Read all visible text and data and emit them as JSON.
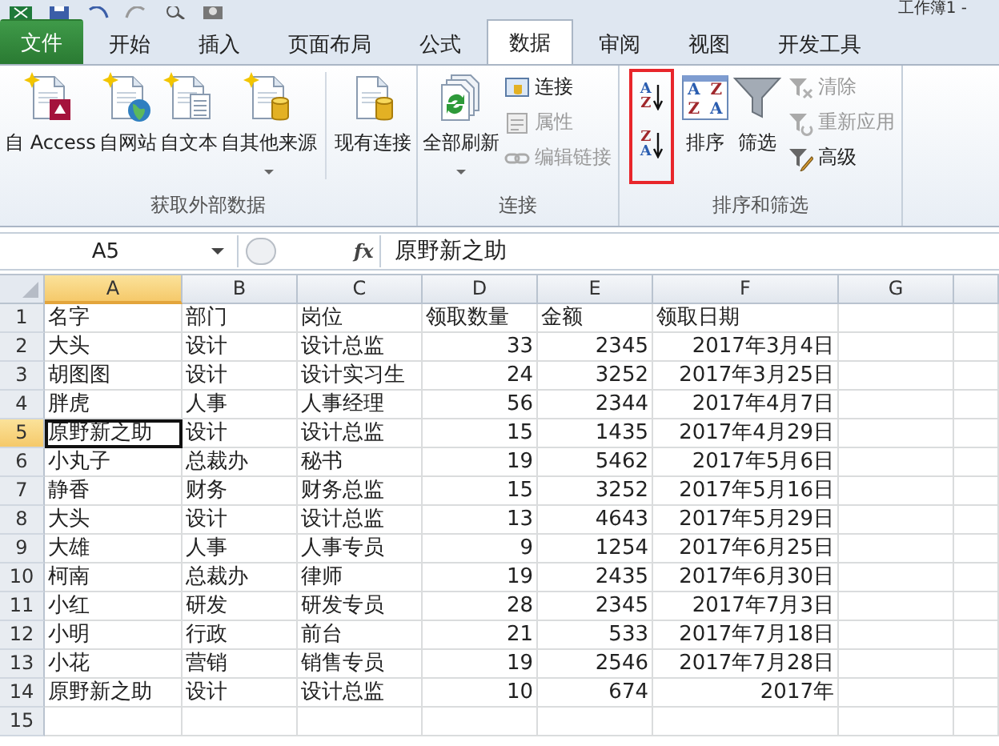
{
  "title_bar": {
    "title": "工作簿1 -"
  },
  "tabs": [
    {
      "label": "文件",
      "kind": "file",
      "selected": false
    },
    {
      "label": "开始",
      "kind": "tab",
      "selected": false
    },
    {
      "label": "插入",
      "kind": "tab",
      "selected": false
    },
    {
      "label": "页面布局",
      "kind": "tab",
      "selected": false
    },
    {
      "label": "公式",
      "kind": "tab",
      "selected": false
    },
    {
      "label": "数据",
      "kind": "tab",
      "selected": true
    },
    {
      "label": "审阅",
      "kind": "tab",
      "selected": false
    },
    {
      "label": "视图",
      "kind": "tab",
      "selected": false
    },
    {
      "label": "开发工具",
      "kind": "tab",
      "selected": false
    }
  ],
  "ribbon": {
    "groups": [
      {
        "label": "获取外部数据",
        "items": [
          {
            "kind": "large",
            "label": "自 Access",
            "dropdown": false
          },
          {
            "kind": "large",
            "label": "自网站",
            "dropdown": false
          },
          {
            "kind": "large",
            "label": "自文本",
            "dropdown": false
          },
          {
            "kind": "large",
            "label": "自其他来源",
            "dropdown": true
          },
          {
            "kind": "separator"
          },
          {
            "kind": "large",
            "label": "现有连接",
            "dropdown": false
          }
        ]
      },
      {
        "label": "连接",
        "items": [
          {
            "kind": "large",
            "label": "全部刷新",
            "dropdown": true
          },
          {
            "kind": "stack",
            "items": [
              {
                "label": "连接",
                "disabled": false
              },
              {
                "label": "属性",
                "disabled": true
              },
              {
                "label": "编辑链接",
                "disabled": true
              }
            ]
          }
        ]
      },
      {
        "label": "排序和筛选",
        "items": [
          {
            "kind": "sortpair",
            "highlighted": true,
            "buttons": [
              {
                "glyphs": [
                  {
                    "text": "A",
                    "color": "#2a5db0"
                  },
                  {
                    "text": "Z",
                    "color": "#a0282c"
                  }
                ]
              },
              {
                "glyphs": [
                  {
                    "text": "Z",
                    "color": "#a0282c"
                  },
                  {
                    "text": "A",
                    "color": "#2a5db0"
                  }
                ]
              }
            ]
          },
          {
            "kind": "sortgrid",
            "label": "排序",
            "glyphs": [
              {
                "text": "A",
                "color": "#2a5db0"
              },
              {
                "text": "Z",
                "color": "#a0282c"
              },
              {
                "text": "Z",
                "color": "#a0282c"
              },
              {
                "text": "A",
                "color": "#2a5db0"
              }
            ]
          },
          {
            "kind": "large",
            "label": "筛选",
            "dropdown": false
          },
          {
            "kind": "stack",
            "items": [
              {
                "label": "清除",
                "disabled": true
              },
              {
                "label": "重新应用",
                "disabled": true
              },
              {
                "label": "高级",
                "disabled": false
              }
            ]
          }
        ]
      }
    ]
  },
  "formula_bar": {
    "name_box": "A5",
    "function_button": "fx",
    "value": "原野新之助"
  },
  "sheet": {
    "columns": [
      {
        "label": "A",
        "selected": true
      },
      {
        "label": "B",
        "selected": false
      },
      {
        "label": "C",
        "selected": false
      },
      {
        "label": "D",
        "selected": false
      },
      {
        "label": "E",
        "selected": false
      },
      {
        "label": "F",
        "selected": false
      },
      {
        "label": "G",
        "selected": false
      }
    ],
    "rows": [
      {
        "number": "1",
        "selected": false,
        "cells": [
          "名字",
          "部门",
          "岗位",
          "领取数量",
          "金额",
          "领取日期"
        ]
      },
      {
        "number": "2",
        "selected": false,
        "cells": [
          "大头",
          "设计",
          "设计总监"
        ],
        "figures": [
          "33",
          "2345",
          "2017年3月4日"
        ]
      },
      {
        "number": "3",
        "selected": false,
        "cells": [
          "胡图图",
          "设计",
          "设计实习生"
        ],
        "figures": [
          "24",
          "3252",
          "2017年3月25日"
        ]
      },
      {
        "number": "4",
        "selected": false,
        "cells": [
          "胖虎",
          "人事",
          "人事经理"
        ],
        "figures": [
          "56",
          "2344",
          "2017年4月7日"
        ]
      },
      {
        "number": "5",
        "selected": true,
        "cells": [
          "原野新之助",
          "设计",
          "设计总监"
        ],
        "figures": [
          "15",
          "1435",
          "2017年4月29日"
        ]
      },
      {
        "number": "6",
        "selected": false,
        "cells": [
          "小丸子",
          "总裁办",
          "秘书"
        ],
        "figures": [
          "19",
          "5462",
          "2017年5月6日"
        ]
      },
      {
        "number": "7",
        "selected": false,
        "cells": [
          "静香",
          "财务",
          "财务总监"
        ],
        "figures": [
          "15",
          "3252",
          "2017年5月16日"
        ]
      },
      {
        "number": "8",
        "selected": false,
        "cells": [
          "大头",
          "设计",
          "设计总监"
        ],
        "figures": [
          "13",
          "4643",
          "2017年5月29日"
        ]
      },
      {
        "number": "9",
        "selected": false,
        "cells": [
          "大雄",
          "人事",
          "人事专员"
        ],
        "figures": [
          "9",
          "1254",
          "2017年6月25日"
        ]
      },
      {
        "number": "10",
        "selected": false,
        "cells": [
          "柯南",
          "总裁办",
          "律师"
        ],
        "figures": [
          "19",
          "2435",
          "2017年6月30日"
        ]
      },
      {
        "number": "11",
        "selected": false,
        "cells": [
          "小红",
          "研发",
          "研发专员"
        ],
        "figures": [
          "28",
          "2345",
          "2017年7月3日"
        ]
      },
      {
        "number": "12",
        "selected": false,
        "cells": [
          "小明",
          "行政",
          "前台"
        ],
        "figures": [
          "21",
          "533",
          "2017年7月18日"
        ]
      },
      {
        "number": "13",
        "selected": false,
        "cells": [
          "小花",
          "营销",
          "销售专员"
        ],
        "figures": [
          "19",
          "2546",
          "2017年7月28日"
        ]
      },
      {
        "number": "14",
        "selected": false,
        "cells": [
          "原野新之助",
          "设计",
          "设计总监"
        ],
        "figures": [
          "10",
          "674",
          "2017年"
        ]
      },
      {
        "number": "15",
        "selected": false
      }
    ]
  }
}
